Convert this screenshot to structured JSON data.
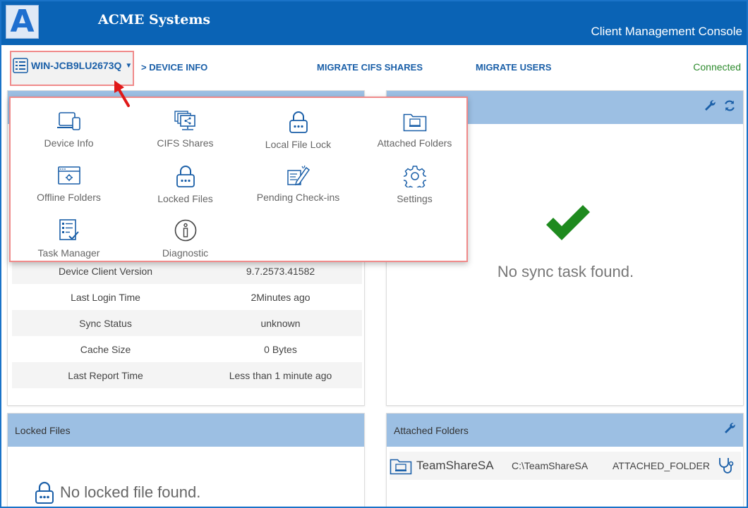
{
  "header": {
    "logo_letter": "A",
    "brand": "ACME Systems",
    "console_title": "Client Management Console"
  },
  "nav": {
    "device_name": "WIN-JCB9LU2673Q",
    "links": [
      "> DEVICE INFO",
      "MIGRATE CIFS SHARES",
      "MIGRATE USERS"
    ],
    "status": "Connected"
  },
  "dropdown": {
    "items": [
      {
        "label": "Device Info",
        "icon": "device-icon"
      },
      {
        "label": "CIFS Shares",
        "icon": "cifs-shares-icon"
      },
      {
        "label": "Local File Lock",
        "icon": "lock-icon"
      },
      {
        "label": "Attached Folders",
        "icon": "attached-folder-icon"
      },
      {
        "label": "Offline Folders",
        "icon": "offline-folder-icon"
      },
      {
        "label": "Locked Files",
        "icon": "lock-icon"
      },
      {
        "label": "Pending Check-ins",
        "icon": "pending-checkin-icon"
      },
      {
        "label": "Settings",
        "icon": "gear-icon"
      },
      {
        "label": "Task Manager",
        "icon": "task-list-icon"
      },
      {
        "label": "Diagnostic",
        "icon": "info-icon"
      }
    ]
  },
  "device_info": {
    "rows": [
      {
        "key": "Device Client Version",
        "value": "9.7.2573.41582"
      },
      {
        "key": "Last Login Time",
        "value": "2Minutes ago"
      },
      {
        "key": "Sync Status",
        "value": "unknown"
      },
      {
        "key": "Cache Size",
        "value": "0 Bytes"
      },
      {
        "key": "Last Report Time",
        "value": "Less than 1 minute ago"
      }
    ]
  },
  "sync_panel": {
    "empty_text": "No sync task found."
  },
  "locked_files": {
    "title": "Locked Files",
    "empty_text": "No locked file found."
  },
  "attached_folders": {
    "title": "Attached Folders",
    "rows": [
      {
        "name": "TeamShareSA",
        "path": "C:\\TeamShareSA",
        "type": "ATTACHED_FOLDER"
      }
    ]
  },
  "colors": {
    "header_bg": "#0a63b5",
    "panel_head_bg": "#9cbfe3",
    "link": "#1a5fa8",
    "connected": "#2e8b2e",
    "check": "#1e8a1e",
    "highlight_border": "#f08a8a"
  }
}
